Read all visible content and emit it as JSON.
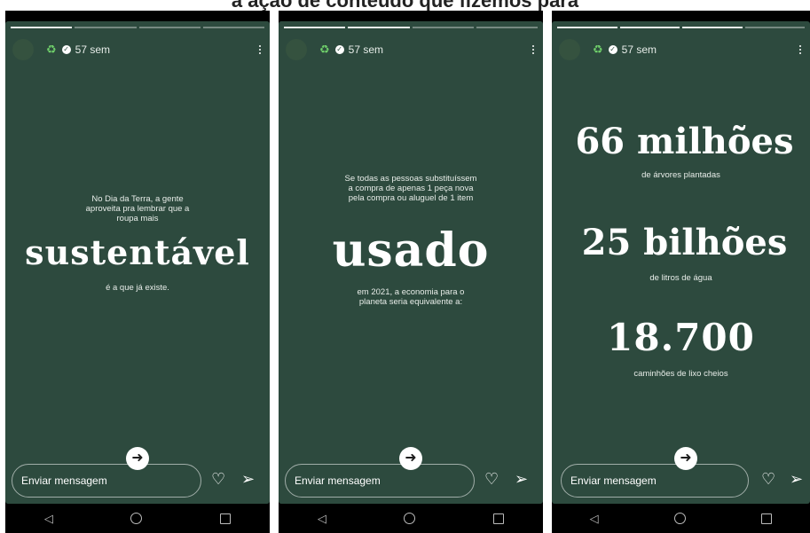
{
  "caption": "a ação de conteúdo que fizemos para",
  "story": {
    "time": "57 sem",
    "reply_placeholder": "Enviar mensagem"
  },
  "panel1": {
    "intro": "No Dia da Terra, a gente aproveita pra lembrar que a roupa mais",
    "big": "sustentável",
    "outro": "é a que já existe."
  },
  "panel2": {
    "intro": "Se todas as pessoas substituíssem a compra de apenas 1 peça nova pela compra ou aluguel de 1 item",
    "big": "usado",
    "outro": "em 2021, a economia para o planeta seria equivalente a:"
  },
  "panel3": {
    "stat1": "66 milhões",
    "stat1_label": "de árvores plantadas",
    "stat2": "25 bilhões",
    "stat2_label": "de litros de água",
    "stat3": "18.700",
    "stat3_label": "caminhões de lixo cheios"
  },
  "colors": {
    "story_bg": "#2d4a3e",
    "accent_logo": "#6fcf6a"
  }
}
